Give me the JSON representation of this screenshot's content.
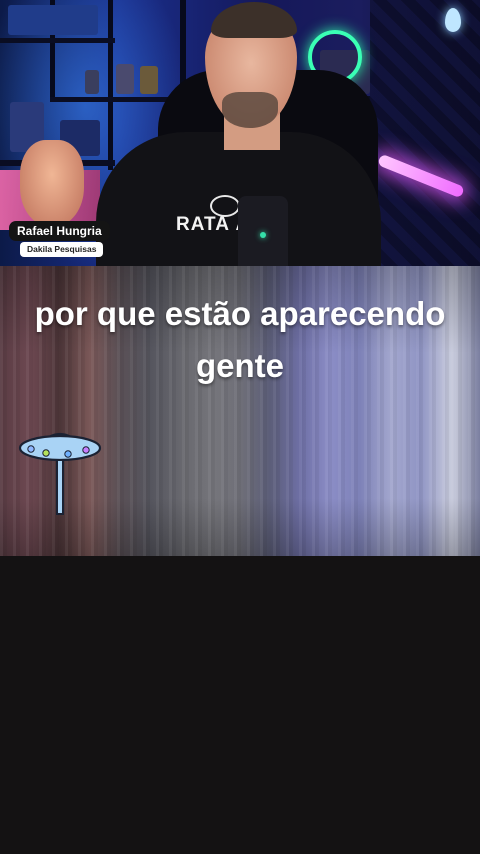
{
  "overlay": {
    "speaker_name": "Rafael Hungria",
    "speaker_org": "Dakila Pesquisas"
  },
  "scene": {
    "shirt_brand": "RATA  ÁÁ"
  },
  "caption": {
    "line1": "por que estão aparecendo",
    "line2": "gente"
  },
  "sticker": {
    "icon": "ufo-icon"
  },
  "colors": {
    "caption_text": "#ffffff",
    "name_tag_bg": "#141414",
    "org_tag_bg": "#ffffff",
    "page_bg": "#141213"
  }
}
